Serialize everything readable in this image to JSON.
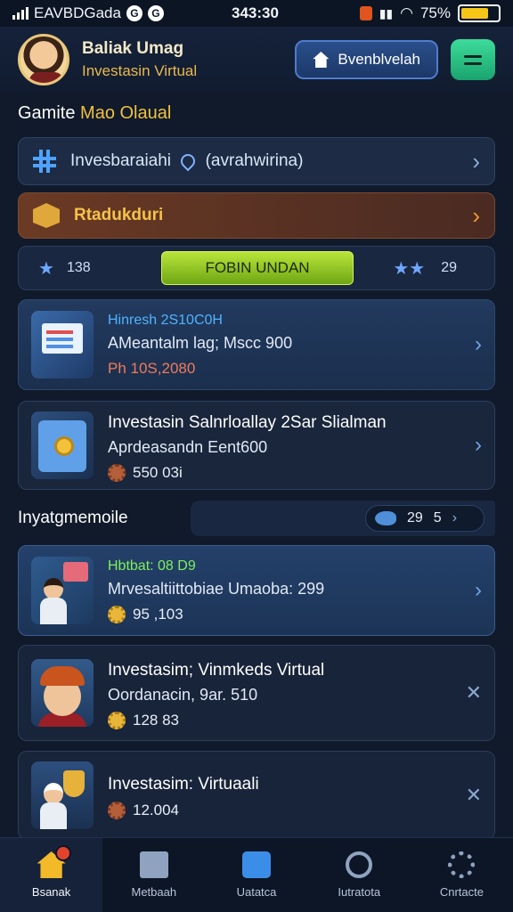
{
  "status_bar": {
    "carrier": "EAVBDGada",
    "time": "343:30",
    "battery": "75%",
    "battery_level": 0.75
  },
  "header": {
    "name": "Baliak Umag",
    "subtitle": "Investasin Virtual",
    "button_label": "Bvenblvelah"
  },
  "section_title": {
    "prefix": "Gamite",
    "accent": "Mao Olaual"
  },
  "rows": {
    "search": {
      "label": "Invesbaraiahi",
      "suffix": "(avrahwirina)"
    },
    "promo": {
      "label": "Rtadukduri"
    },
    "stats": {
      "left_value": "138",
      "cta_label": "FOBIN UNDAN",
      "right_value": "29"
    }
  },
  "cards": [
    {
      "kicker": "Hinresh 2S10C0H",
      "title": "AMeantalm lag; Mscc 900",
      "price": "Ph 10S,2080",
      "kicker_color": "#4fb3ff",
      "price_color": "#f07a5a"
    },
    {
      "title": "Investasin Salnrloallay 2Sar Slialman",
      "sub": "Aprdeasandn Eent600",
      "price": "550 03i"
    }
  ],
  "sub_header": {
    "title": "Inyatgmemoile",
    "count": "29",
    "count2": "5"
  },
  "cards2": [
    {
      "kicker": "Hbtbat: 08 D9",
      "sub": "Mrvesaltiittobiae Umaoba: 299",
      "price": "95 ,103",
      "kicker_color": "#7df05a"
    },
    {
      "title": "Investasim; Vinmkeds Virtual",
      "sub": "Oordanacin, 9ar. 510",
      "price": "128 83"
    },
    {
      "title": "Investasim: Virtuaali",
      "price": "12.004"
    }
  ],
  "bottom_nav": [
    {
      "label": "Bsanak",
      "icon": "home-icon",
      "active": true
    },
    {
      "label": "Metbaah",
      "icon": "document-icon",
      "active": false
    },
    {
      "label": "Uatatca",
      "icon": "card-icon",
      "active": false
    },
    {
      "label": "Iutratota",
      "icon": "rocket-icon",
      "active": false
    },
    {
      "label": "Cnrtacte",
      "icon": "gear-icon",
      "active": false
    }
  ],
  "colors": {
    "background": "#101a2a",
    "accent_gold": "#f0c040",
    "cta_green": "#9ed12a",
    "promo_brown": "#6b3a24"
  }
}
